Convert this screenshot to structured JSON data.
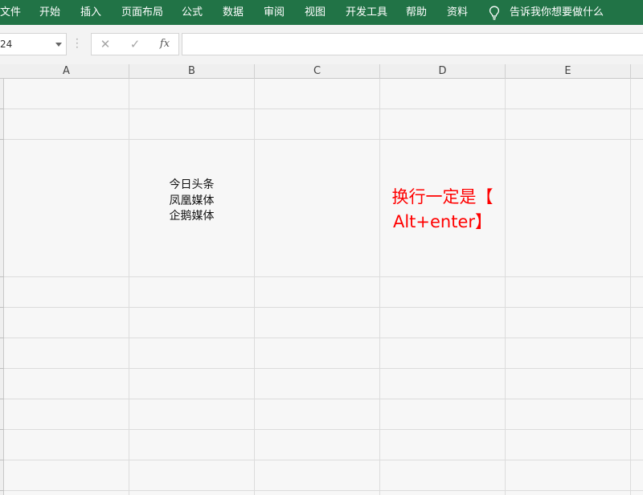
{
  "menu": {
    "items": [
      "文件",
      "开始",
      "插入",
      "页面布局",
      "公式",
      "数据",
      "审阅",
      "视图",
      "开发工具",
      "帮助",
      "资料"
    ],
    "tell_me": "告诉我你想要做什么"
  },
  "formula_bar": {
    "name_box": "24",
    "cancel_symbol": "✕",
    "enter_symbol": "✓",
    "fx_symbol": "fx",
    "formula_value": ""
  },
  "columns": [
    "A",
    "B",
    "C",
    "D",
    "E"
  ],
  "cells": {
    "b6_lines": [
      "今日头条",
      "凤凰媒体",
      "企鹅媒体"
    ],
    "d6_lines": [
      "换行一定是【",
      "Alt+enter】"
    ]
  },
  "colors": {
    "ribbon_green": "#217346",
    "annotation_red": "#ff0000"
  },
  "icons": {
    "tell_me": "lightbulb-icon",
    "name_box_dropdown": "chevron-down-icon"
  }
}
